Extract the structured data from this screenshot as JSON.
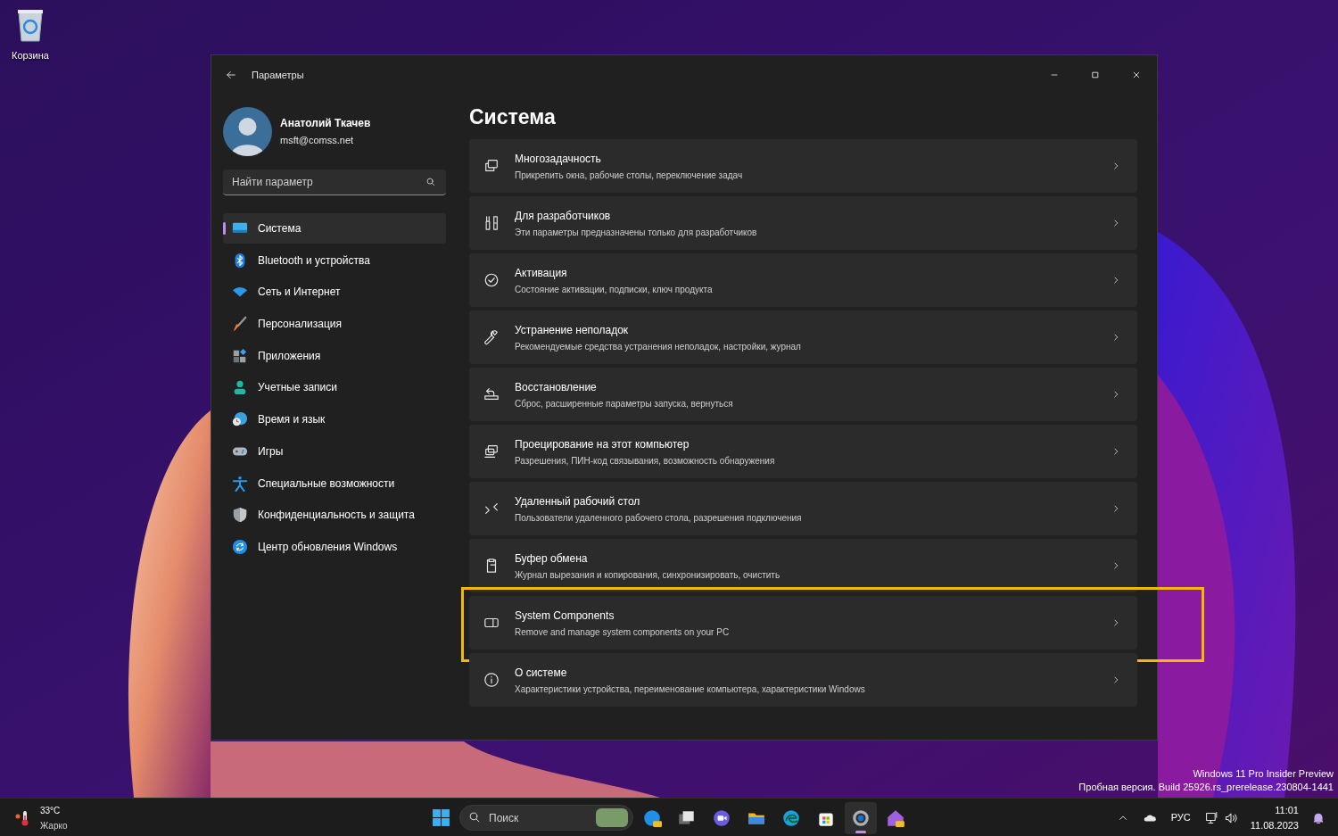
{
  "desktop_icons": [
    {
      "label": "Корзина"
    }
  ],
  "window": {
    "title": "Параметры",
    "user": {
      "name": "Анатолий Ткачев",
      "email": "msft@comss.net"
    },
    "search": {
      "placeholder": "Найти параметр"
    },
    "nav": [
      {
        "label": "Система",
        "selected": true
      },
      {
        "label": "Bluetooth и устройства",
        "selected": false
      },
      {
        "label": "Сеть и Интернет",
        "selected": false
      },
      {
        "label": "Персонализация",
        "selected": false
      },
      {
        "label": "Приложения",
        "selected": false
      },
      {
        "label": "Учетные записи",
        "selected": false
      },
      {
        "label": "Время и язык",
        "selected": false
      },
      {
        "label": "Игры",
        "selected": false
      },
      {
        "label": "Специальные возможности",
        "selected": false
      },
      {
        "label": "Конфиденциальность и защита",
        "selected": false
      },
      {
        "label": "Центр обновления Windows",
        "selected": false
      }
    ],
    "page_title": "Система",
    "settings": [
      {
        "title": "Многозадачность",
        "description": "Прикрепить окна, рабочие столы, переключение задач",
        "highlighted": false
      },
      {
        "title": "Для разработчиков",
        "description": "Эти параметры предназначены только для разработчиков",
        "highlighted": false
      },
      {
        "title": "Активация",
        "description": "Состояние активации, подписки, ключ продукта",
        "highlighted": false
      },
      {
        "title": "Устранение неполадок",
        "description": "Рекомендуемые средства устранения неполадок, настройки, журнал",
        "highlighted": false
      },
      {
        "title": "Восстановление",
        "description": "Сброс, расширенные параметры запуска, вернуться",
        "highlighted": false
      },
      {
        "title": "Проецирование на этот компьютер",
        "description": "Разрешения, ПИН-код связывания, возможность обнаружения",
        "highlighted": false
      },
      {
        "title": "Удаленный рабочий стол",
        "description": "Пользователи удаленного рабочего стола, разрешения подключения",
        "highlighted": false
      },
      {
        "title": "Буфер обмена",
        "description": "Журнал вырезания и копирования, синхронизировать, очистить",
        "highlighted": false
      },
      {
        "title": "System Components",
        "description": "Remove and manage system components on your PC",
        "highlighted": true
      },
      {
        "title": "О системе",
        "description": "Характеристики устройства, переименование компьютера, характеристики Windows",
        "highlighted": false
      }
    ]
  },
  "build_info": [
    "Windows 11 Pro Insider Preview",
    "Пробная версия. Build 25926.rs_prerelease.230804-1441"
  ],
  "taskbar": {
    "weather": {
      "temperature": "33°C",
      "condition": "Жарко"
    },
    "search": {
      "placeholder": "Поиск"
    },
    "apps": [
      {
        "selected": false
      },
      {
        "selected": false
      },
      {
        "selected": false
      },
      {
        "selected": false
      },
      {
        "selected": false
      },
      {
        "selected": false
      },
      {
        "selected": true
      },
      {
        "selected": false
      }
    ],
    "language": "РУС",
    "time": "11:01",
    "date": "11.08.2023"
  }
}
